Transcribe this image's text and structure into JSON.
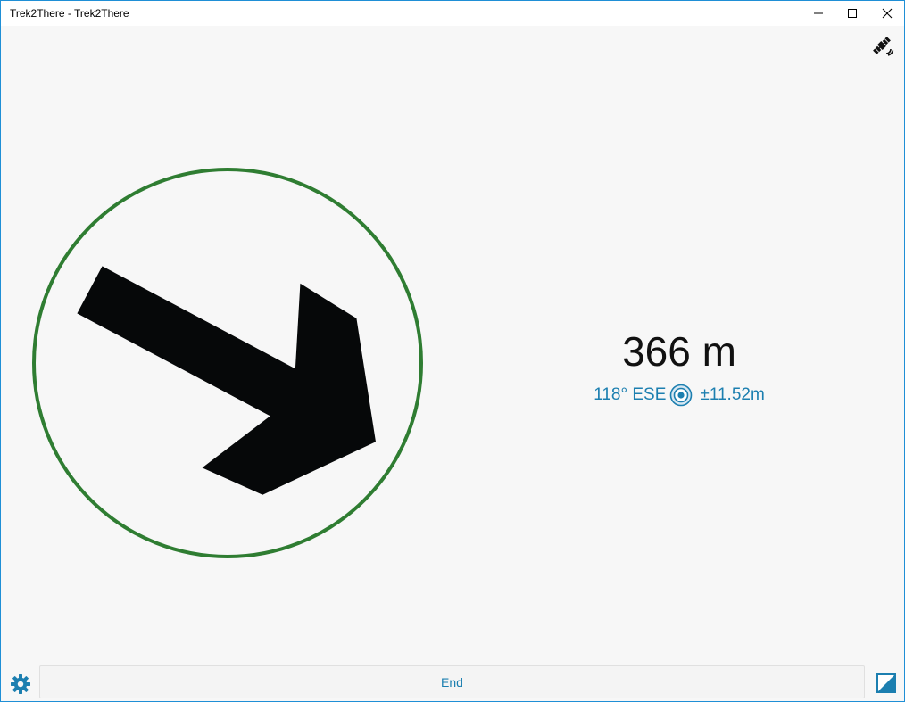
{
  "window": {
    "title": "Trek2There - Trek2There"
  },
  "titlebar_buttons": {
    "minimize_icon": "minimize-icon",
    "maximize_icon": "maximize-icon",
    "close_icon": "close-icon"
  },
  "status": {
    "gps_icon": "satellite-icon"
  },
  "navigation": {
    "distance": "366 m",
    "heading": "118° ESE",
    "accuracy": "±11.52m",
    "accuracy_icon": "gps-accuracy-icon",
    "bearing_degrees": 118,
    "compass_ring_color": "#2f7d32",
    "arrow_color": "#060809"
  },
  "toolbar": {
    "settings_icon": "gear-icon",
    "end_label": "End",
    "theme_icon": "day-night-toggle-icon",
    "accent_color": "#1c7fb0"
  }
}
